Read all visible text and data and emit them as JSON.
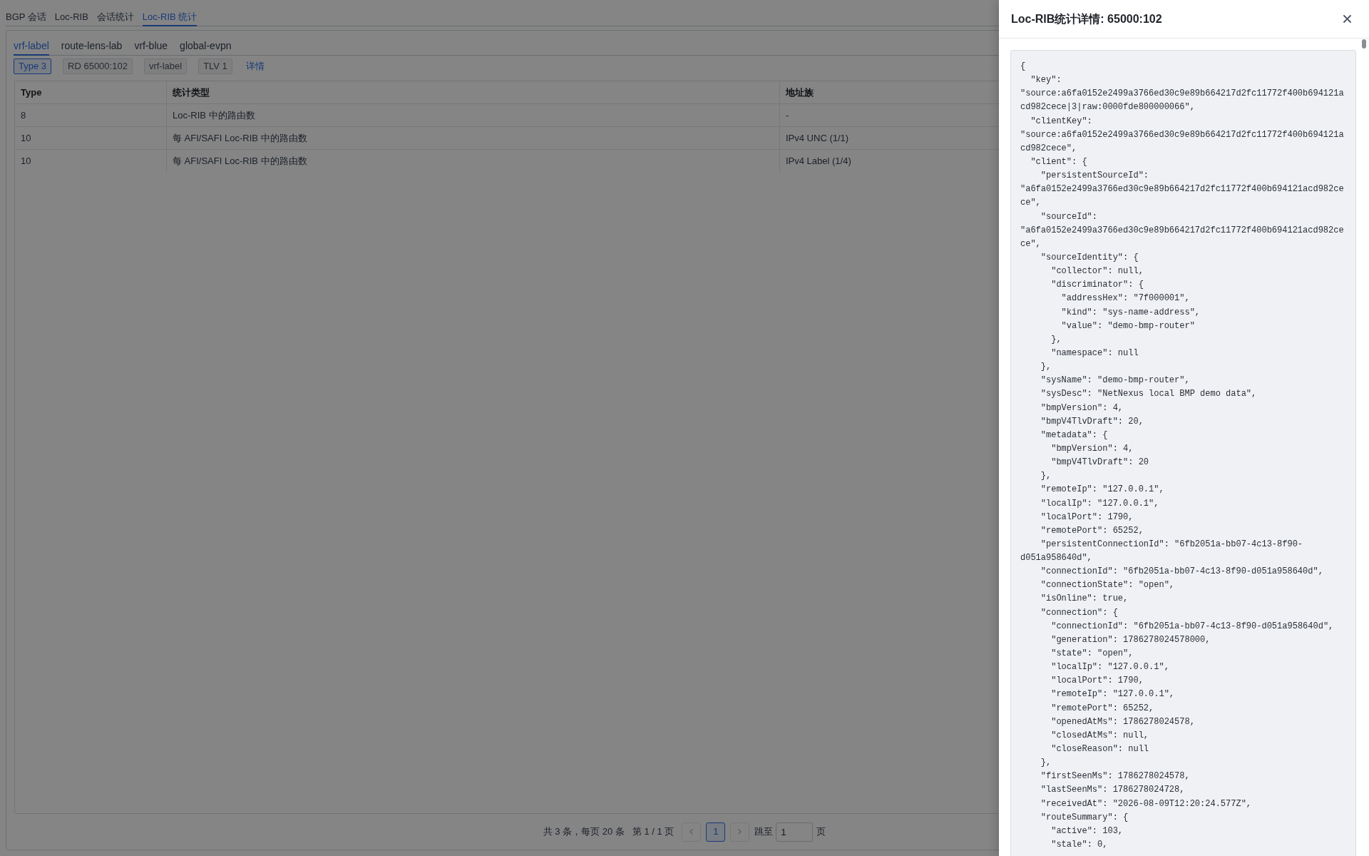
{
  "tabs": [
    {
      "label": "BGP 会话",
      "selected": false
    },
    {
      "label": "Loc-RIB",
      "selected": false
    },
    {
      "label": "会话统计",
      "selected": false
    },
    {
      "label": "Loc-RIB 统计",
      "selected": true
    }
  ],
  "subtabs": [
    {
      "label": "vrf-label",
      "selected": true
    },
    {
      "label": "route-lens-lab",
      "selected": false
    },
    {
      "label": "vrf-blue",
      "selected": false
    },
    {
      "label": "global-evpn",
      "selected": false
    }
  ],
  "tags": [
    {
      "label": "Type 3",
      "kind": "primary"
    },
    {
      "label": "RD 65000:102",
      "kind": "plain"
    },
    {
      "label": "vrf-label",
      "kind": "plain"
    },
    {
      "label": "TLV 1",
      "kind": "plain"
    }
  ],
  "details_link": "详情",
  "table": {
    "columns": [
      "Type",
      "统计类型",
      "地址族"
    ],
    "rows": [
      [
        "8",
        "Loc-RIB 中的路由数",
        "-"
      ],
      [
        "10",
        "每 AFI/SAFI Loc-RIB 中的路由数",
        "IPv4 UNC (1/1)"
      ],
      [
        "10",
        "每 AFI/SAFI Loc-RIB 中的路由数",
        "IPv4 Label (1/4)"
      ]
    ]
  },
  "pagination": {
    "summary": "共 3 条，每页 20 条",
    "page_info": "第 1 / 1 页",
    "prev": {
      "disabled": true
    },
    "pages": [
      {
        "label": "1",
        "selected": true
      }
    ],
    "next": {
      "disabled": true
    },
    "jump": {
      "label": "跳至",
      "value": "1",
      "suffix": "页"
    }
  },
  "drawer": {
    "title": "Loc-RIB统计详情: 65000:102",
    "code_lines": [
      "{",
      "  \"key\":",
      "\"source:a6fa0152e2499a3766ed30c9e89b664217d2fc11772f400b694121a",
      "cd982cece|3|raw:0000fde800000066\",",
      "  \"clientKey\":",
      "\"source:a6fa0152e2499a3766ed30c9e89b664217d2fc11772f400b694121a",
      "cd982cece\",",
      "  \"client\": {",
      "    \"persistentSourceId\":",
      "\"a6fa0152e2499a3766ed30c9e89b664217d2fc11772f400b694121acd982ce",
      "ce\",",
      "    \"sourceId\":",
      "\"a6fa0152e2499a3766ed30c9e89b664217d2fc11772f400b694121acd982ce",
      "ce\",",
      "    \"sourceIdentity\": {",
      "      \"collector\": null,",
      "      \"discriminator\": {",
      "        \"addressHex\": \"7f000001\",",
      "        \"kind\": \"sys-name-address\",",
      "        \"value\": \"demo-bmp-router\"",
      "      },",
      "      \"namespace\": null",
      "    },",
      "    \"sysName\": \"demo-bmp-router\",",
      "    \"sysDesc\": \"NetNexus local BMP demo data\",",
      "    \"bmpVersion\": 4,",
      "    \"bmpV4TlvDraft\": 20,",
      "    \"metadata\": {",
      "      \"bmpVersion\": 4,",
      "      \"bmpV4TlvDraft\": 20",
      "    },",
      "    \"remoteIp\": \"127.0.0.1\",",
      "    \"localIp\": \"127.0.0.1\",",
      "    \"localPort\": 1790,",
      "    \"remotePort\": 65252,",
      "    \"persistentConnectionId\": \"6fb2051a-bb07-4c13-8f90-",
      "d051a958640d\",",
      "    \"connectionId\": \"6fb2051a-bb07-4c13-8f90-d051a958640d\",",
      "    \"connectionState\": \"open\",",
      "    \"isOnline\": true,",
      "    \"connection\": {",
      "      \"connectionId\": \"6fb2051a-bb07-4c13-8f90-d051a958640d\",",
      "      \"generation\": 1786278024578000,",
      "      \"state\": \"open\",",
      "      \"localIp\": \"127.0.0.1\",",
      "      \"localPort\": 1790,",
      "      \"remoteIp\": \"127.0.0.1\",",
      "      \"remotePort\": 65252,",
      "      \"openedAtMs\": 1786278024578,",
      "      \"closedAtMs\": null,",
      "      \"closeReason\": null",
      "    },",
      "    \"firstSeenMs\": 1786278024578,",
      "    \"lastSeenMs\": 1786278024728,",
      "    \"receivedAt\": \"2026-08-09T12:20:24.577Z\",",
      "    \"routeSummary\": {",
      "      \"active\": 103,",
      "      \"stale\": 0,"
    ]
  }
}
